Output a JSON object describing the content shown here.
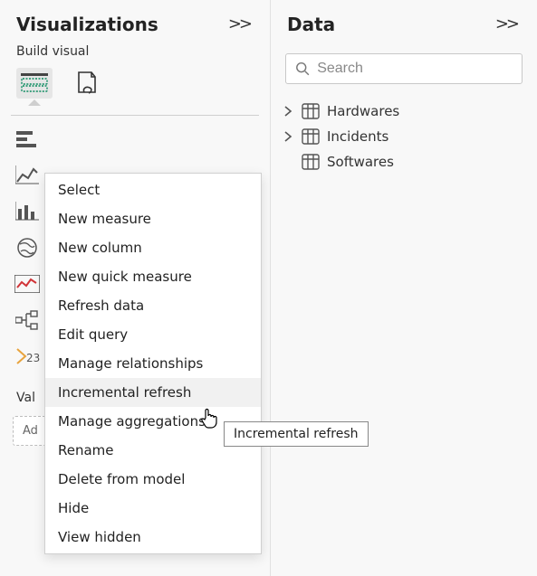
{
  "visualizations": {
    "title": "Visualizations",
    "sub_header": "Build visual",
    "values_label": "Val",
    "dropzone_placeholder": "Ad"
  },
  "data": {
    "title": "Data",
    "search_placeholder": "Search",
    "tables": [
      {
        "name": "Hardwares",
        "expanded": false,
        "chevron": true
      },
      {
        "name": "Incidents",
        "expanded": false,
        "chevron": true
      },
      {
        "name": "Softwares",
        "expanded": false,
        "chevron": false
      }
    ]
  },
  "context_menu": {
    "items": [
      "Select",
      "New measure",
      "New column",
      "New quick measure",
      "Refresh data",
      "Edit query",
      "Manage relationships",
      "Incremental refresh",
      "Manage aggregations",
      "Rename",
      "Delete from model",
      "Hide",
      "View hidden"
    ],
    "hovered_index": 7
  },
  "tooltip": {
    "text": "Incremental refresh"
  }
}
